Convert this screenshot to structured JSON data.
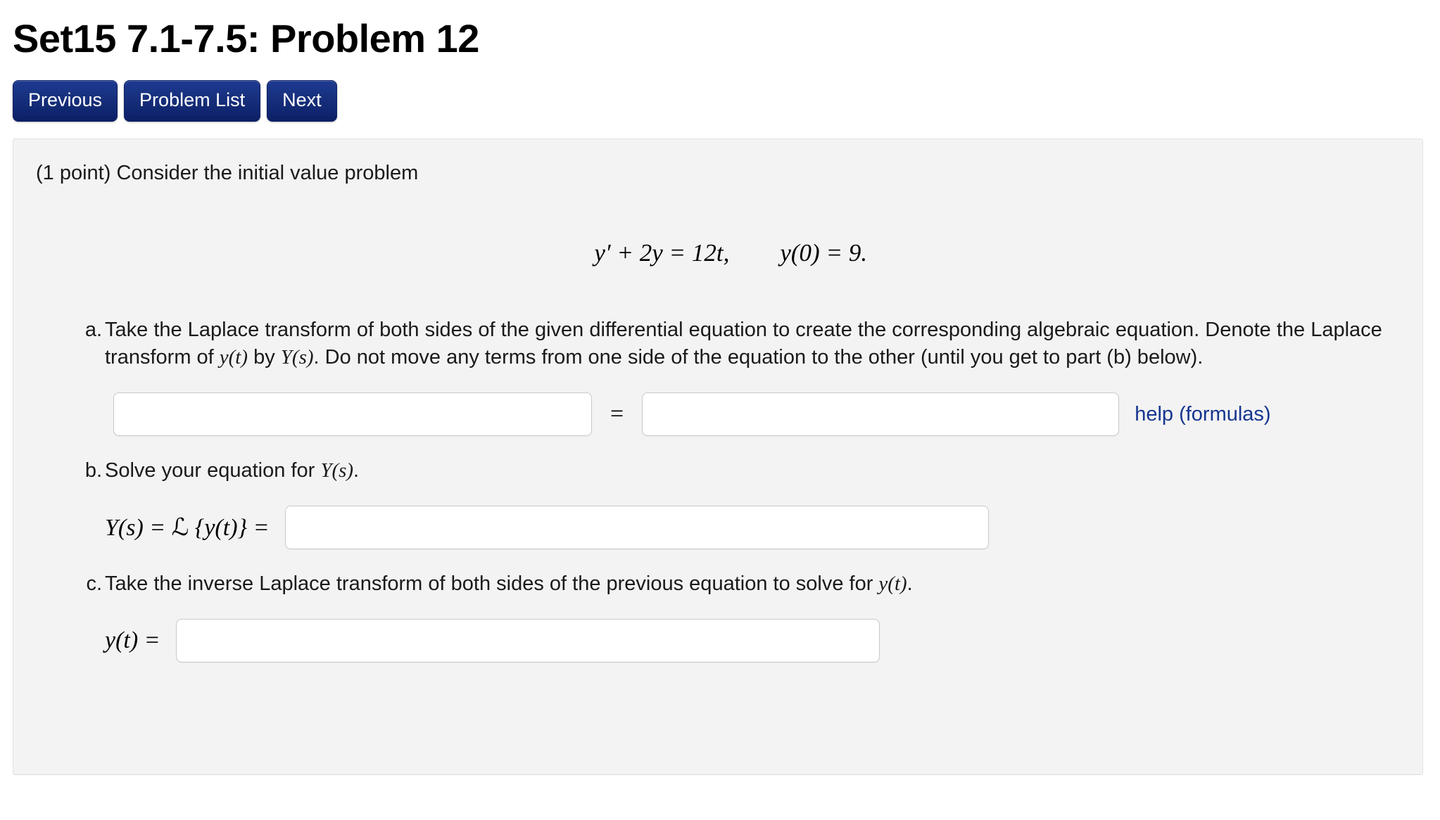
{
  "header": {
    "title": "Set15 7.1-7.5: Problem 12"
  },
  "nav": {
    "buttons": [
      {
        "label": "Previous",
        "name": "previous-button"
      },
      {
        "label": "Problem List",
        "name": "problem-list-button"
      },
      {
        "label": "Next",
        "name": "next-button"
      }
    ]
  },
  "problem": {
    "intro": "(1 point) Consider the initial value problem",
    "equation": "y′ + 2y = 12t,  y(0) = 9.",
    "equation_parts": {
      "lhs": "y′ + 2y = 12t,",
      "initial_condition": "y(0) = 9."
    },
    "parts": [
      {
        "marker": "a.",
        "text": "Take the Laplace transform of both sides of the given differential equation to create the corresponding algebraic equation. Denote the Laplace transform of y(t) by Y(s). Do not move any terms from one side of the equation to the other (until you get to part (b) below).",
        "segments": {
          "s1": "Take the Laplace transform of both sides of the given differential equation to create the corresponding algebraic equation. Denote the Laplace transform of ",
          "m1": "y(t)",
          "s2": " by ",
          "m2": "Y(s)",
          "s3": ". Do not move any terms from one side of the equation to the other (until you get to part (b) below)."
        }
      },
      {
        "marker": "b.",
        "text": "Solve your equation for Y(s).",
        "segments": {
          "s1": "Solve your equation for ",
          "m1": "Y(s)",
          "s2": "."
        }
      },
      {
        "marker": "c.",
        "text": "Take the inverse Laplace transform of both sides of the previous equation to solve for y(t).",
        "segments": {
          "s1": "Take the inverse Laplace transform of both sides of the previous equation to solve for ",
          "m1": "y(t)",
          "s2": "."
        }
      }
    ],
    "answers": {
      "a": {
        "left_value": "",
        "left_placeholder": "",
        "equals": "=",
        "right_value": "",
        "right_placeholder": "",
        "help_label": "help (formulas)"
      },
      "b": {
        "label": "Y(s) = ℒ {y(t)} =",
        "label_parts": {
          "ys": "Y(s) = ",
          "script": "ℒ",
          "rest": " {y(t)} ="
        },
        "value": "",
        "placeholder": ""
      },
      "c": {
        "label": "y(t) =",
        "value": "",
        "placeholder": ""
      }
    }
  },
  "colors": {
    "button_blue_top": "#1d3a91",
    "button_blue_bottom": "#0b1f66",
    "link_blue": "#16368f",
    "panel_bg": "#f3f3f3",
    "panel_border": "#e3e3e3",
    "input_border": "#c9c9c9",
    "text": "#1a1a1a"
  }
}
